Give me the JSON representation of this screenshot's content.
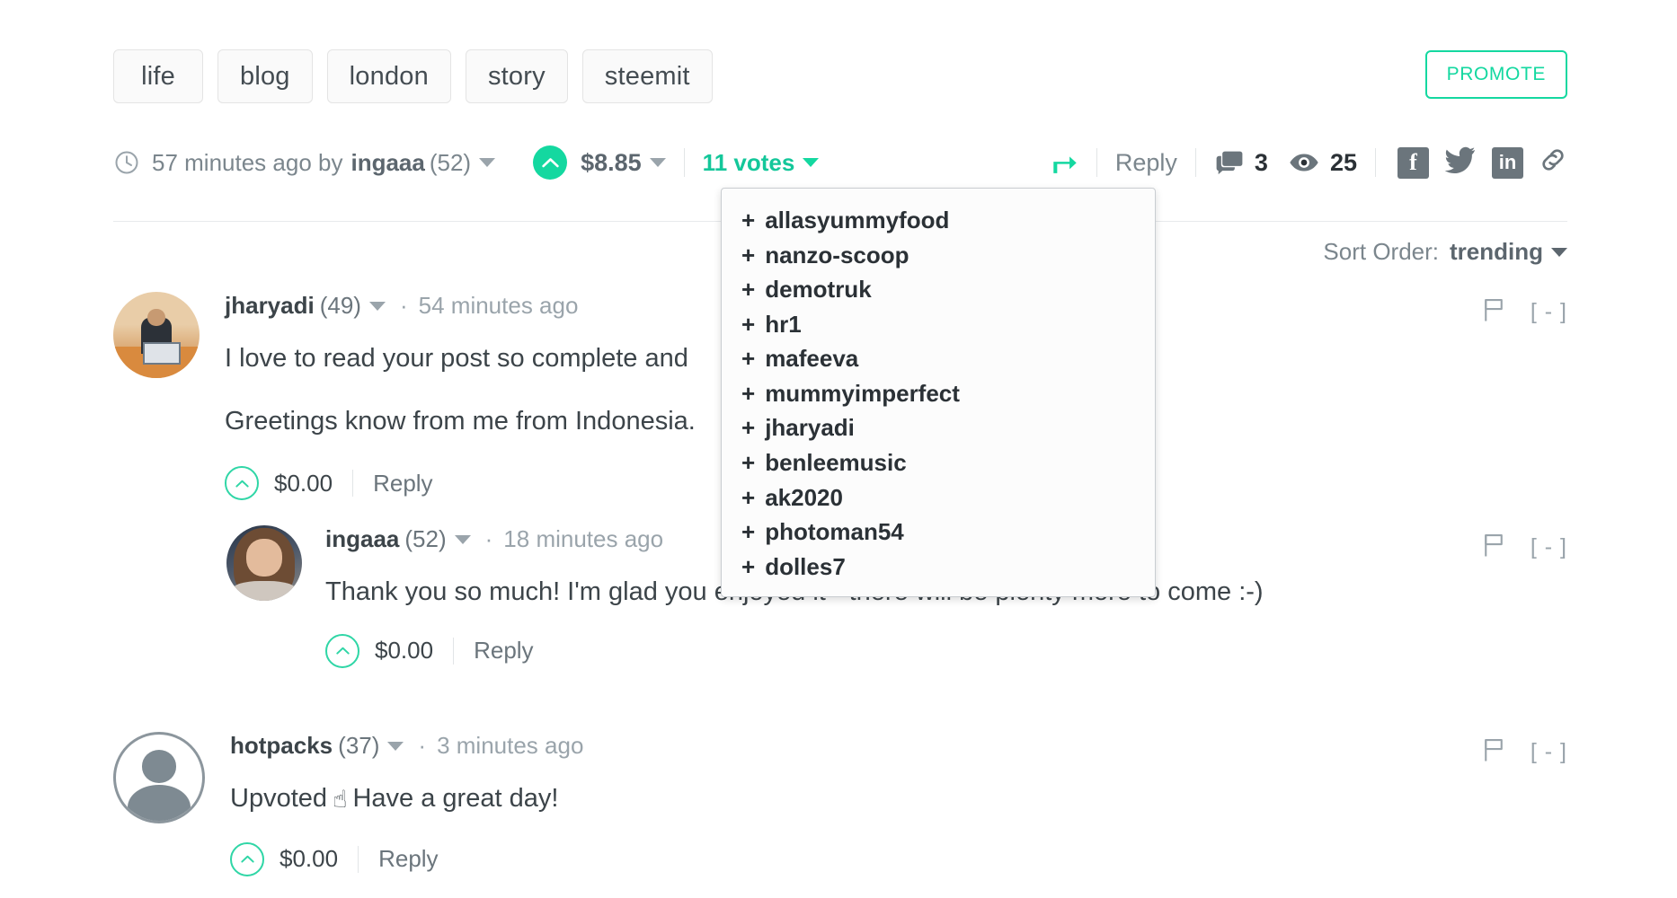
{
  "tags": [
    "life",
    "blog",
    "london",
    "story",
    "steemit"
  ],
  "promote": {
    "label": "PROMOTE"
  },
  "post_meta": {
    "clock_icon": "clock-icon",
    "time": "57 minutes ago by",
    "author": "ingaaa",
    "reputation": "(52)",
    "payout": "$8.85",
    "votes": "11 votes",
    "resteem_icon": "resteem-arrow-icon",
    "reply_label": "Reply",
    "comment_icon": "comment-bubble-icon",
    "comment_count": "3",
    "views_icon": "eye-icon",
    "views_count": "25",
    "share": {
      "facebook": "f",
      "twitter": "twitter-bird-icon",
      "linkedin": "in",
      "link": "link-chain-icon"
    }
  },
  "votes_menu": {
    "items": [
      "allasyummyfood",
      "nanzo-scoop",
      "demotruk",
      "hr1",
      "mafeeva",
      "mummyimperfect",
      "jharyadi",
      "benleemusic",
      "ak2020",
      "photoman54",
      "dolles7"
    ],
    "prefix": "+"
  },
  "sort_order": {
    "label": "Sort Order:",
    "value": "trending"
  },
  "comments": [
    {
      "author": "jharyadi",
      "reputation": "(49)",
      "separator": "·",
      "time": "54 minutes ago",
      "text_line1": "I love to read your post so complete and",
      "text_line2": "Greetings know from me from Indonesia.",
      "payout": "$0.00",
      "reply_label": "Reply",
      "flag_icon": "flag-icon",
      "collapse": "[ - ]"
    },
    {
      "author": "ingaaa",
      "reputation": "(52)",
      "separator": "·",
      "time": "18 minutes ago",
      "text_line1": "Thank you so much! I'm glad you enjoyed it - there will be plenty more to come :-)",
      "payout": "$0.00",
      "reply_label": "Reply",
      "flag_icon": "flag-icon",
      "collapse": "[ - ]"
    },
    {
      "author": "hotpacks",
      "reputation": "(37)",
      "separator": "·",
      "time": "3 minutes ago",
      "text_before_emoji": "Upvoted",
      "emoji": "☝",
      "text_after_emoji": "Have a great day!",
      "payout": "$0.00",
      "reply_label": "Reply",
      "flag_icon": "flag-icon",
      "collapse": "[ - ]"
    }
  ],
  "colors": {
    "accent_green": "#14d8a0",
    "text_dark": "#3c4449",
    "text_muted": "#7b868d",
    "border": "#e4e4e4"
  }
}
